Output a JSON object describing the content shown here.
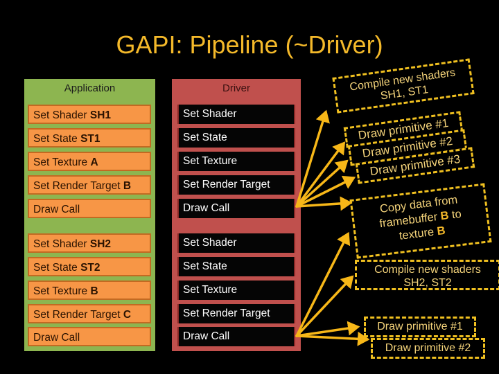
{
  "title": "GAPI: Pipeline (~Driver)",
  "application": {
    "header": "Application",
    "rows": [
      {
        "text": "Set Shader ",
        "bold": "SH1"
      },
      {
        "text": "Set State ",
        "bold": "ST1"
      },
      {
        "text": "Set Texture ",
        "bold": "A"
      },
      {
        "text": "Set Render Target ",
        "bold": "B"
      },
      {
        "text": "Draw Call",
        "bold": ""
      },
      {
        "text": "Set Shader ",
        "bold": "SH2"
      },
      {
        "text": "Set State ",
        "bold": "ST2"
      },
      {
        "text": "Set Texture ",
        "bold": "B"
      },
      {
        "text": "Set Render Target ",
        "bold": "C"
      },
      {
        "text": "Draw Call",
        "bold": ""
      }
    ]
  },
  "driver": {
    "header": "Driver",
    "rows": [
      "Set Shader",
      "Set State",
      "Set Texture",
      "Set Render Target",
      "Draw Call",
      "Set Shader",
      "Set State",
      "Set Texture",
      "Set Render Target",
      "Draw Call"
    ]
  },
  "notes": {
    "compile1": {
      "line1": "Compile new shaders",
      "line2": "SH1, ST1"
    },
    "draw1": "Draw primitive #1",
    "draw2": "Draw primitive #2",
    "draw3": "Draw primitive #3",
    "copy": {
      "line1": "Copy data from",
      "line2a": "framebuffer ",
      "line2b": "B",
      "line2c": " to",
      "line3a": "texture ",
      "line3b": "B"
    },
    "compile2": {
      "line1": "Compile new shaders",
      "line2": "SH2, ST2"
    },
    "draw2_1": "Draw primitive #1",
    "draw2_2": "Draw primitive #2"
  },
  "colors": {
    "title": "#f4b92a",
    "application_bg": "#8db550",
    "application_cell": "#f79646",
    "driver_bg": "#c0504d",
    "driver_cell": "#050505",
    "arrow": "#f7b718",
    "note_border": "#f0c020"
  }
}
